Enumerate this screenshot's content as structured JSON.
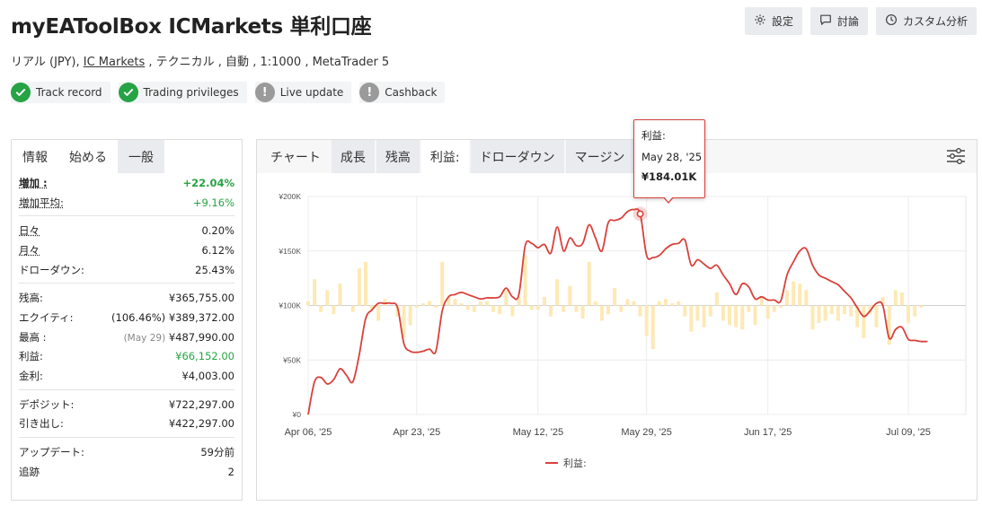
{
  "header": {
    "title": "myEAToolBox ICMarkets 単利口座",
    "actions": [
      {
        "label": "設定",
        "icon": "gear-icon"
      },
      {
        "label": "討論",
        "icon": "comment-icon"
      },
      {
        "label": "カスタム分析",
        "icon": "clock-icon"
      }
    ]
  },
  "subtitle": {
    "prefix": "リアル (JPY), ",
    "broker": "IC Markets",
    "suffix": " , テクニカル , 自動 , 1:1000 , MetaTrader 5"
  },
  "badges": [
    {
      "label": "Track record",
      "status": "ok"
    },
    {
      "label": "Trading privileges",
      "status": "ok"
    },
    {
      "label": "Live update",
      "status": "warn"
    },
    {
      "label": "Cashback",
      "status": "warn"
    }
  ],
  "left_tabs": [
    "情報",
    "始める",
    "一般"
  ],
  "stats": {
    "gain_label": "増加 :",
    "gain_value": "+22.04%",
    "avg_gain_label": "増加平均:",
    "avg_gain_value": "+9.16%",
    "daily_label": "日々",
    "daily_value": "0.20%",
    "monthly_label": "月々",
    "monthly_value": "6.12%",
    "drawdown_label": "ドローダウン:",
    "drawdown_value": "25.43%",
    "balance_label": "残高:",
    "balance_value": "¥365,755.00",
    "equity_label": "エクイティ:",
    "equity_pre": "(106.46%)",
    "equity_value": "¥389,372.00",
    "highest_label": "最高 :",
    "highest_pre": "(May 29)",
    "highest_value": "¥487,990.00",
    "profit_label": "利益:",
    "profit_value": "¥66,152.00",
    "interest_label": "金利:",
    "interest_value": "¥4,003.00",
    "deposits_label": "デポジット:",
    "deposits_value": "¥722,297.00",
    "withdrawals_label": "引き出し:",
    "withdrawals_value": "¥422,297.00",
    "updated_label": "アップデート:",
    "updated_value": "59分前",
    "tracking_label": "追跡",
    "tracking_value": "2"
  },
  "right_tabs": [
    "チャート",
    "成長",
    "残高",
    "利益:",
    "ドローダウン",
    "マージン"
  ],
  "tooltip": {
    "series": "利益:",
    "date": "May 28, '25",
    "value": "¥184.01K"
  },
  "colors": {
    "line": "#d9413b",
    "bar": "#fde9b5",
    "green": "#26a344",
    "badge_warn": "#9a9a9a"
  },
  "chart_data": {
    "type": "line",
    "title": "",
    "xlabel": "",
    "ylabel": "",
    "ylim": [
      0,
      200000
    ],
    "y_ticks": [
      "¥0",
      "¥50K",
      "¥100K",
      "¥150K",
      "¥200K"
    ],
    "x_ticks": [
      "Apr 06, '25",
      "Apr 23, '25",
      "May 12, '25",
      "May 29, '25",
      "Jun 17, '25",
      "Jul 09, '25"
    ],
    "x_start": "2025-04-06",
    "x_end": "2025-07-18",
    "legend": "bottom-center",
    "series": [
      {
        "name": "利益:",
        "dates": [
          "2025-04-06",
          "2025-04-07",
          "2025-04-08",
          "2025-04-09",
          "2025-04-10",
          "2025-04-11",
          "2025-04-12",
          "2025-04-13",
          "2025-04-14",
          "2025-04-15",
          "2025-04-16",
          "2025-04-17",
          "2025-04-18",
          "2025-04-19",
          "2025-04-20",
          "2025-04-21",
          "2025-04-22",
          "2025-04-23",
          "2025-04-24",
          "2025-04-25",
          "2025-04-26",
          "2025-04-27",
          "2025-04-28",
          "2025-04-29",
          "2025-04-30",
          "2025-05-01",
          "2025-05-02",
          "2025-05-03",
          "2025-05-04",
          "2025-05-05",
          "2025-05-06",
          "2025-05-07",
          "2025-05-08",
          "2025-05-09",
          "2025-05-10",
          "2025-05-11",
          "2025-05-12",
          "2025-05-13",
          "2025-05-14",
          "2025-05-15",
          "2025-05-16",
          "2025-05-17",
          "2025-05-18",
          "2025-05-19",
          "2025-05-20",
          "2025-05-21",
          "2025-05-22",
          "2025-05-23",
          "2025-05-24",
          "2025-05-25",
          "2025-05-26",
          "2025-05-27",
          "2025-05-28",
          "2025-05-29",
          "2025-05-30",
          "2025-05-31",
          "2025-06-01",
          "2025-06-02",
          "2025-06-03",
          "2025-06-04",
          "2025-06-05",
          "2025-06-06",
          "2025-06-07",
          "2025-06-08",
          "2025-06-09",
          "2025-06-10",
          "2025-06-11",
          "2025-06-12",
          "2025-06-13",
          "2025-06-14",
          "2025-06-15",
          "2025-06-16",
          "2025-06-17",
          "2025-06-18",
          "2025-06-19",
          "2025-06-20",
          "2025-06-21",
          "2025-06-22",
          "2025-06-23",
          "2025-06-24",
          "2025-06-25",
          "2025-06-26",
          "2025-06-27",
          "2025-06-28",
          "2025-06-29",
          "2025-06-30",
          "2025-07-01",
          "2025-07-02",
          "2025-07-03",
          "2025-07-04",
          "2025-07-05",
          "2025-07-06",
          "2025-07-07",
          "2025-07-08",
          "2025-07-09",
          "2025-07-10",
          "2025-07-11",
          "2025-07-12",
          "2025-07-13",
          "2025-07-14",
          "2025-07-15",
          "2025-07-16",
          "2025-07-17",
          "2025-07-18"
        ],
        "values": [
          0,
          30000,
          34000,
          28000,
          32000,
          42000,
          36000,
          30000,
          55000,
          88000,
          96000,
          102000,
          102000,
          102000,
          98000,
          65000,
          58000,
          57000,
          58000,
          60000,
          58000,
          95000,
          108000,
          110000,
          112000,
          110000,
          108000,
          106000,
          107000,
          107000,
          108000,
          116000,
          108000,
          110000,
          155000,
          157000,
          153000,
          156000,
          148000,
          172000,
          150000,
          162000,
          155000,
          157000,
          174000,
          162000,
          150000,
          176000,
          178000,
          180000,
          186000,
          188000,
          184010,
          146000,
          144000,
          146000,
          152000,
          156000,
          157000,
          160000,
          137000,
          142000,
          138000,
          134000,
          137000,
          128000,
          120000,
          110000,
          120000,
          117000,
          106000,
          108000,
          105000,
          105000,
          104000,
          128000,
          140000,
          150000,
          152000,
          137000,
          128000,
          125000,
          122000,
          119000,
          113000,
          107000,
          98000,
          90000,
          95000,
          102000,
          100000,
          70000,
          78000,
          80000,
          69000,
          68000,
          67000,
          67000
        ],
        "bars": [
          4000,
          24000,
          -6000,
          14000,
          -8000,
          20000,
          0,
          -6000,
          34000,
          40000,
          -4000,
          -14000,
          6000,
          0,
          -10000,
          -30000,
          -18000,
          -2000,
          2000,
          4000,
          -2000,
          40000,
          8000,
          6000,
          2000,
          -4000,
          -6000,
          4000,
          4000,
          -6000,
          -8000,
          14000,
          -10000,
          8000,
          46000,
          -4000,
          -4000,
          8000,
          -10000,
          24000,
          -6000,
          18000,
          -6000,
          -12000,
          40000,
          4000,
          -14000,
          -8000,
          16000,
          -6000,
          6000,
          4000,
          -10000,
          -28000,
          -40000,
          4000,
          6000,
          2000,
          4000,
          -10000,
          -24000,
          -14000,
          -20000,
          -10000,
          12000,
          -14000,
          -18000,
          -20000,
          -22000,
          -6000,
          -18000,
          8000,
          -12000,
          -6000,
          -2000,
          14000,
          22000,
          20000,
          14000,
          -22000,
          -16000,
          -14000,
          -8000,
          -14000,
          -8000,
          -10000,
          -20000,
          -30000,
          -8000,
          -20000,
          8000,
          -36000,
          14000,
          12000,
          -16000,
          -10000,
          -2000,
          0
        ]
      }
    ],
    "highlight": {
      "date": "2025-05-28",
      "value": 184010
    }
  }
}
